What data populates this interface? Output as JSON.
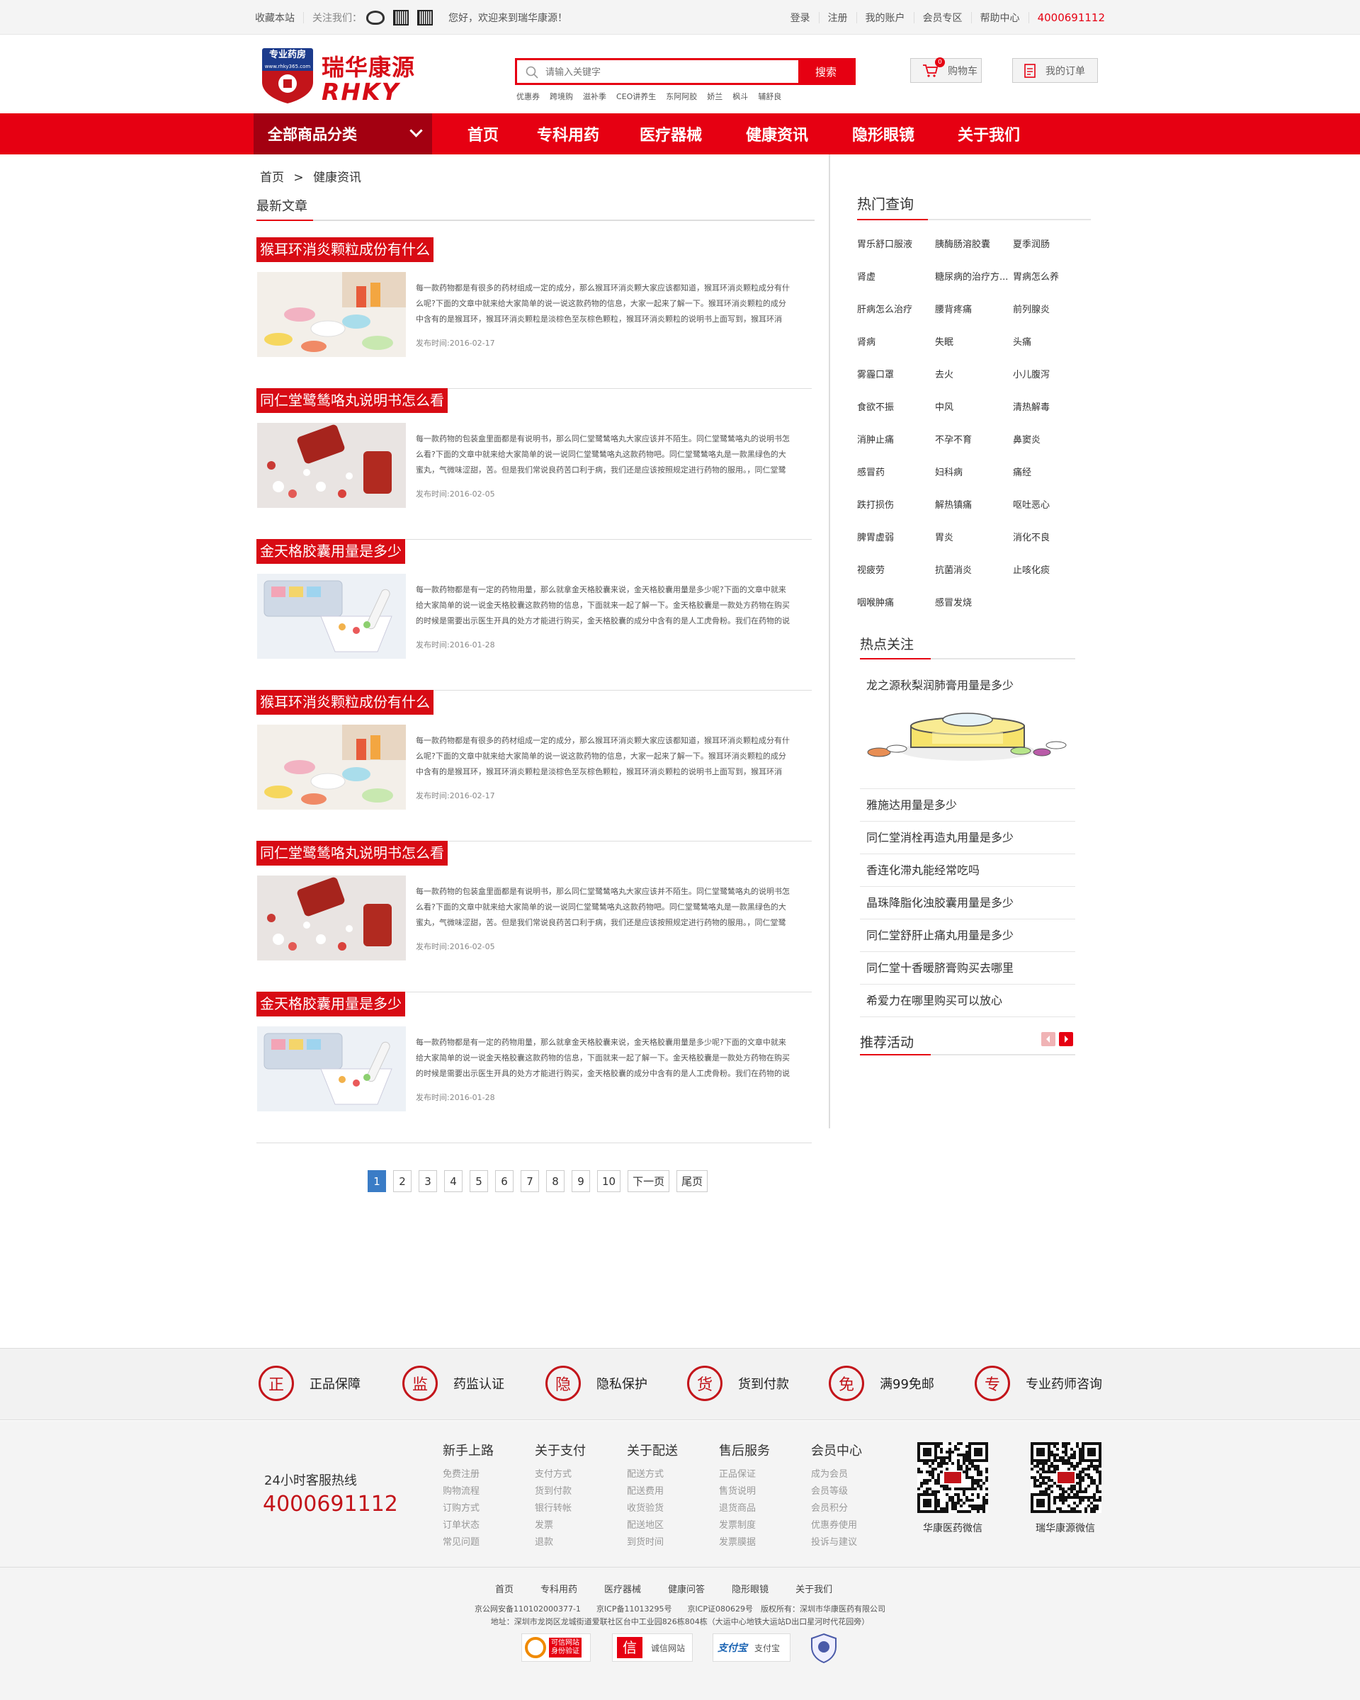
{
  "topbar": {
    "bookmark": "收藏本站",
    "follow": "关注我们：",
    "welcome": "您好，欢迎来到瑞华康源！",
    "links": [
      "登录",
      "注册",
      "我的账户",
      "会员专区",
      "帮助中心"
    ],
    "phone": "4000691112"
  },
  "header": {
    "logo_badge": "专业药房",
    "logo_url": "www.rhky365.com",
    "logo_cn": "瑞华康源",
    "logo_en": "RHKY",
    "search_placeholder": "请输入关键字",
    "search_button": "搜索",
    "hotwords": [
      "优惠券",
      "跨境购",
      "滋补季",
      "CEO讲养生",
      "东阿阿胶",
      "娇兰",
      "枫斗",
      "辅舒良"
    ],
    "cart_label": "购物车",
    "cart_count": "0",
    "orders_label": "我的订单"
  },
  "nav": {
    "all_categories": "全部商品分类",
    "items": [
      "首页",
      "专科用药",
      "医疗器械",
      "健康资讯",
      "隐形眼镜",
      "关于我们"
    ]
  },
  "breadcrumb": {
    "home": "首页",
    "sep": ">",
    "current": "健康资讯"
  },
  "main": {
    "section_title": "最新文章",
    "articles": [
      {
        "title": "猴耳环消炎颗粒成份有什么",
        "desc": "每一款药物都是有很多的药材组成一定的成分，那么猴耳环消炎颗大家应该都知道，猴耳环消炎颗粒成分有什么呢?下面的文章中就来给大家简单的说一说这款药物的信息，大家一起来了解一下。猴耳环消炎颗粒的成分中含有的是猴耳环，猴耳环消炎颗粒是淡棕色至灰棕色颗粒，猴耳环消炎颗粒的说明书上面写到，猴耳环消",
        "date": "发布时间:2016-02-17"
      },
      {
        "title": "同仁堂鹭鸶咯丸说明书怎么看",
        "desc": "每一款药物的包装盒里面都是有说明书，那么同仁堂鹭鸶咯丸大家应该并不陌生。同仁堂鹭鸶咯丸的说明书怎么看?下面的文章中就来给大家简单的说一说同仁堂鹭鸶咯丸这款药物吧。同仁堂鹭鸶咯丸是一款黑绿色的大蜜丸，气微味涩甜，苦。但是我们常说良药苦口利于病，我们还是应该按照规定进行药物的服用。，同仁堂鹭",
        "date": "发布时间:2016-02-05"
      },
      {
        "title": "金天格胶囊用量是多少",
        "desc": "每一款药物都是有一定的药物用量，那么就拿金天格胶囊来说，金天格胶囊用量是多少呢?下面的文章中就来给大家简单的说一说金天格胶囊这款药物的信息，下面就来一起了解一下。金天格胶囊是一款处方药物在购买的时候是需要出示医生开具的处方才能进行购买，金天格胶囊的成分中含有的是人工虎骨粉。我们在药物的说",
        "date": "发布时间:2016-01-28"
      },
      {
        "title": "猴耳环消炎颗粒成份有什么",
        "desc": "每一款药物都是有很多的药材组成一定的成分，那么猴耳环消炎颗大家应该都知道，猴耳环消炎颗粒成分有什么呢?下面的文章中就来给大家简单的说一说这款药物的信息，大家一起来了解一下。猴耳环消炎颗粒的成分中含有的是猴耳环，猴耳环消炎颗粒是淡棕色至灰棕色颗粒，猴耳环消炎颗粒的说明书上面写到，猴耳环消",
        "date": "发布时间:2016-02-17"
      },
      {
        "title": "同仁堂鹭鸶咯丸说明书怎么看",
        "desc": "每一款药物的包装盒里面都是有说明书，那么同仁堂鹭鸶咯丸大家应该并不陌生。同仁堂鹭鸶咯丸的说明书怎么看?下面的文章中就来给大家简单的说一说同仁堂鹭鸶咯丸这款药物吧。同仁堂鹭鸶咯丸是一款黑绿色的大蜜丸，气微味涩甜，苦。但是我们常说良药苦口利于病，我们还是应该按照规定进行药物的服用。，同仁堂鹭",
        "date": "发布时间:2016-02-05"
      },
      {
        "title": "金天格胶囊用量是多少",
        "desc": "每一款药物都是有一定的药物用量，那么就拿金天格胶囊来说，金天格胶囊用量是多少呢?下面的文章中就来给大家简单的说一说金天格胶囊这款药物的信息，下面就来一起了解一下。金天格胶囊是一款处方药物在购买的时候是需要出示医生开具的处方才能进行购买，金天格胶囊的成分中含有的是人工虎骨粉。我们在药物的说",
        "date": "发布时间:2016-01-28"
      }
    ]
  },
  "sidebar": {
    "hot_query_title": "热门查询",
    "hot_queries": [
      "胃乐舒口服液",
      "胰酶肠溶胶囊",
      "夏季润肠",
      "肾虚",
      "糖尿病的治疗方...",
      "胃病怎么养",
      "肝病怎么治疗",
      "腰背疼痛",
      "前列腺炎",
      "肾病",
      "失眠",
      "头痛",
      "雾霾口罩",
      "去火",
      "小儿腹泻",
      "食欲不振",
      "中风",
      "清热解毒",
      "消肿止痛",
      "不孕不育",
      "鼻窦炎",
      "感冒药",
      "妇科病",
      "痛经",
      "跌打损伤",
      "解热镇痛",
      "呕吐恶心",
      "脾胃虚弱",
      "胃炎",
      "消化不良",
      "视疲劳",
      "抗菌消炎",
      "止咳化痰",
      "咽喉肿痛",
      "感冒发烧"
    ],
    "focus_title": "热点关注",
    "focus_top": "龙之源秋梨润肺膏用量是多少",
    "focus_items": [
      "雅施达用量是多少",
      "同仁堂消栓再造丸用量是多少",
      "香连化滞丸能经常吃吗",
      "晶珠降脂化浊胶囊用量是多少",
      "同仁堂舒肝止痛丸用量是多少",
      "同仁堂十香暖脐膏购买去哪里",
      "希爱力在哪里购买可以放心"
    ],
    "activity_title": "推荐活动"
  },
  "pager": {
    "pages": [
      "1",
      "2",
      "3",
      "4",
      "5",
      "6",
      "7",
      "8",
      "9",
      "10"
    ],
    "next": "下一页",
    "last": "尾页",
    "current": "1"
  },
  "features": [
    {
      "icon": "正",
      "label": "正品保障"
    },
    {
      "icon": "监",
      "label": "药监认证"
    },
    {
      "icon": "隐",
      "label": "隐私保护"
    },
    {
      "icon": "货",
      "label": "货到付款"
    },
    {
      "icon": "免",
      "label": "满99免邮"
    },
    {
      "icon": "专",
      "label": "专业药师咨询"
    }
  ],
  "footer": {
    "hotline_label": "24小时客服热线",
    "hotline": "4000691112",
    "columns": [
      {
        "title": "新手上路",
        "links": [
          "免费注册",
          "购物流程",
          "订购方式",
          "订单状态",
          "常见问题"
        ]
      },
      {
        "title": "关于支付",
        "links": [
          "支付方式",
          "货到付款",
          "银行转帐",
          "发票",
          "退款"
        ]
      },
      {
        "title": "关于配送",
        "links": [
          "配送方式",
          "配送费用",
          "收货验货",
          "配送地区",
          "到货时间"
        ]
      },
      {
        "title": "售后服务",
        "links": [
          "正品保证",
          "售货说明",
          "退货商品",
          "发票制度",
          "发票膜据"
        ]
      },
      {
        "title": "会员中心",
        "links": [
          "成为会员",
          "会员等级",
          "会员积分",
          "优惠券使用",
          "投诉与建议"
        ]
      }
    ],
    "qr1_caption": "华康医药微信",
    "qr2_caption": "瑞华康源微信",
    "bottom_links": [
      "首页",
      "专科用药",
      "医疗器械",
      "健康问答",
      "隐形眼镜",
      "关于我们"
    ],
    "copyright1": "京公网安备110102000377-1　　京ICP备11013295号　　京ICP证080629号　版权所有：深圳市华康医药有限公司",
    "copyright2": "地址：深圳市龙岗区龙城街道爱联社区台中工业园826栋804栋（大运中心地铁大运站D出口星河时代花园旁）",
    "badges": [
      "可信网站",
      "诚信网站",
      "支付宝"
    ],
    "badge_sub": "身份验证"
  }
}
